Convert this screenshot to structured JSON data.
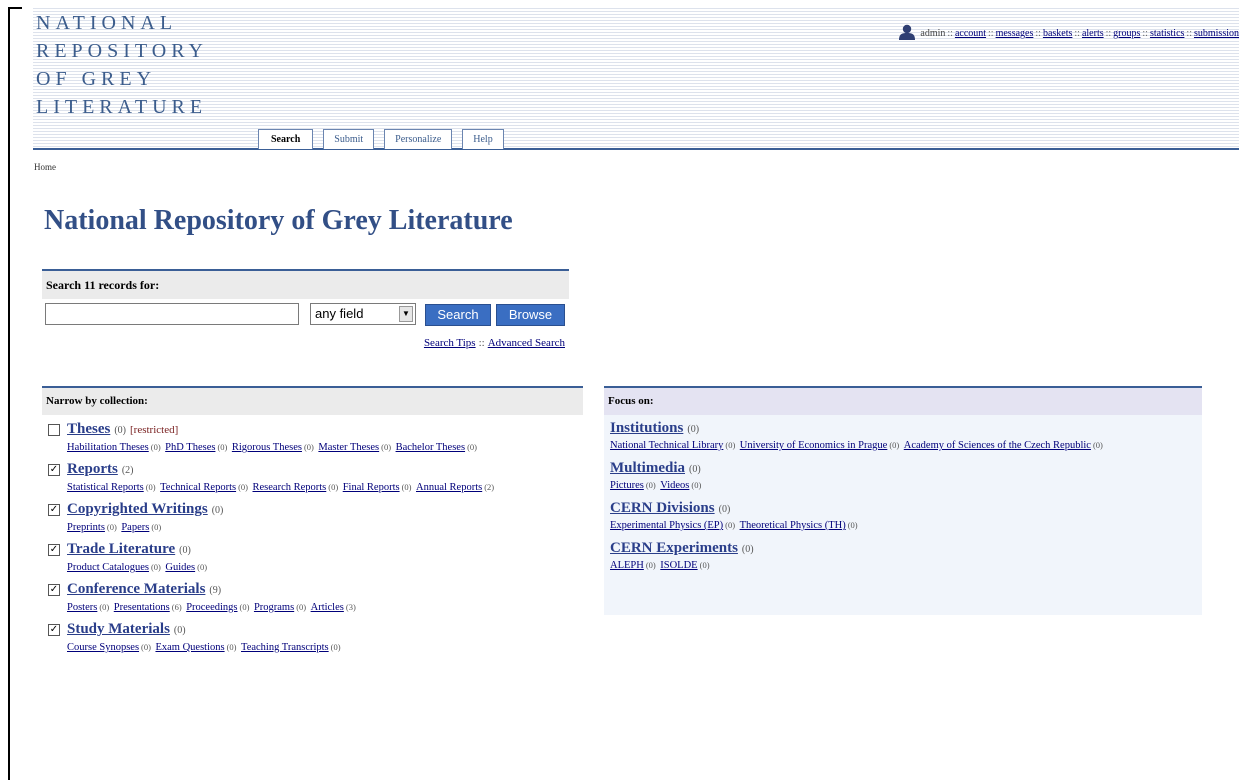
{
  "logo": {
    "lines": [
      "NATIONAL",
      "REPOSITORY",
      "OF GREY",
      "LITERATURE"
    ]
  },
  "user_nav": {
    "items": [
      "admin",
      "account",
      "messages",
      "baskets",
      "alerts",
      "groups",
      "statistics",
      "submission"
    ],
    "separator": "::"
  },
  "tabs": [
    {
      "label": "Search",
      "active": true
    },
    {
      "label": "Submit",
      "active": false
    },
    {
      "label": "Personalize",
      "active": false
    },
    {
      "label": "Help",
      "active": false
    }
  ],
  "breadcrumb": "Home",
  "page_title": "National Repository of Grey Literature",
  "search": {
    "heading": "Search 11 records for:",
    "input_value": "",
    "field_selected": "any field",
    "search_button": "Search",
    "browse_button": "Browse",
    "tips_link": "Search Tips",
    "advanced_link": "Advanced Search",
    "links_separator": "::"
  },
  "narrow": {
    "heading": "Narrow by collection:",
    "collections": [
      {
        "name": "Theses",
        "count": "(0)",
        "restricted": "[restricted]",
        "checked": false,
        "subs": [
          {
            "name": "Habilitation Theses",
            "count": "(0)"
          },
          {
            "name": "PhD Theses",
            "count": "(0)"
          },
          {
            "name": "Rigorous Theses",
            "count": "(0)"
          },
          {
            "name": "Master Theses",
            "count": "(0)"
          },
          {
            "name": "Bachelor Theses",
            "count": "(0)"
          }
        ]
      },
      {
        "name": "Reports",
        "count": "(2)",
        "restricted": "",
        "checked": true,
        "subs": [
          {
            "name": "Statistical Reports",
            "count": "(0)"
          },
          {
            "name": "Technical Reports",
            "count": "(0)"
          },
          {
            "name": "Research Reports",
            "count": "(0)"
          },
          {
            "name": "Final Reports",
            "count": "(0)"
          },
          {
            "name": "Annual Reports",
            "count": "(2)"
          }
        ]
      },
      {
        "name": "Copyrighted Writings",
        "count": "(0)",
        "restricted": "",
        "checked": true,
        "subs": [
          {
            "name": "Preprints",
            "count": "(0)"
          },
          {
            "name": "Papers",
            "count": "(0)"
          }
        ]
      },
      {
        "name": "Trade Literature",
        "count": "(0)",
        "restricted": "",
        "checked": true,
        "subs": [
          {
            "name": "Product Catalogues",
            "count": "(0)"
          },
          {
            "name": "Guides",
            "count": "(0)"
          }
        ]
      },
      {
        "name": "Conference Materials",
        "count": "(9)",
        "restricted": "",
        "checked": true,
        "subs": [
          {
            "name": "Posters",
            "count": "(0)"
          },
          {
            "name": "Presentations",
            "count": "(6)"
          },
          {
            "name": "Proceedings",
            "count": "(0)"
          },
          {
            "name": "Programs",
            "count": "(0)"
          },
          {
            "name": "Articles",
            "count": "(3)"
          }
        ]
      },
      {
        "name": "Study Materials",
        "count": "(0)",
        "restricted": "",
        "checked": true,
        "subs": [
          {
            "name": "Course Synopses",
            "count": "(0)"
          },
          {
            "name": "Exam Questions",
            "count": "(0)"
          },
          {
            "name": "Teaching Transcripts",
            "count": "(0)"
          }
        ]
      }
    ]
  },
  "focus": {
    "heading": "Focus on:",
    "collections": [
      {
        "name": "Institutions",
        "count": "(0)",
        "subs": [
          {
            "name": "National Technical Library",
            "count": "(0)"
          },
          {
            "name": "University of Economics in Prague",
            "count": "(0)"
          },
          {
            "name": "Academy of Sciences of the Czech Republic",
            "count": "(0)"
          }
        ]
      },
      {
        "name": "Multimedia",
        "count": "(0)",
        "subs": [
          {
            "name": "Pictures",
            "count": "(0)"
          },
          {
            "name": "Videos",
            "count": "(0)"
          }
        ]
      },
      {
        "name": "CERN Divisions",
        "count": "(0)",
        "subs": [
          {
            "name": "Experimental Physics (EP)",
            "count": "(0)"
          },
          {
            "name": "Theoretical Physics (TH)",
            "count": "(0)"
          }
        ]
      },
      {
        "name": "CERN Experiments",
        "count": "(0)",
        "subs": [
          {
            "name": "ALEPH",
            "count": "(0)"
          },
          {
            "name": "ISOLDE",
            "count": "(0)"
          }
        ]
      }
    ]
  }
}
